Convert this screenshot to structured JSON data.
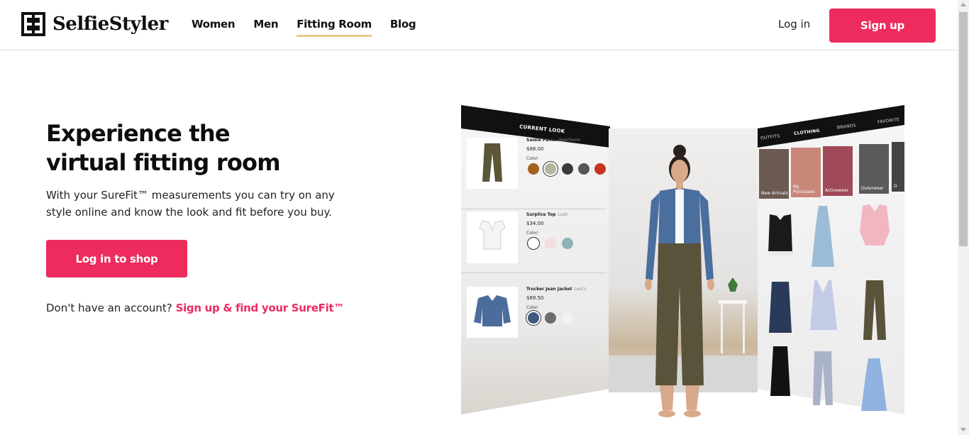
{
  "header": {
    "brand": "SelfieStyler",
    "nav": [
      {
        "label": "Women"
      },
      {
        "label": "Men"
      },
      {
        "label": "Fitting Room",
        "active": true
      },
      {
        "label": "Blog"
      }
    ],
    "login_label": "Log in",
    "signup_label": "Sign up"
  },
  "hero": {
    "title_line1": "Experience the",
    "title_line2": "virtual fitting room",
    "description": "With your SureFit™ measurements you can try on any style online and know the look and fit before you buy.",
    "shop_button": "Log in to shop",
    "account_prompt": "Don't have an account?",
    "account_link": "Sign up & find your SureFit™"
  },
  "fitting_room": {
    "current_look_label": "CURRENT LOOK",
    "items": [
      {
        "name": "Saidie Pants",
        "brand": "Heartloom",
        "price": "$88.00",
        "color_label": "Color:",
        "swatches": [
          "#a4611f",
          "#b6b59d",
          "#3b3b3b",
          "#555657",
          "#c8341f"
        ],
        "img_icon": "pants-icon"
      },
      {
        "name": "Surplice Top",
        "brand": "Lush",
        "price": "$34.00",
        "color_label": "Color:",
        "swatches": [
          "#ffffff",
          "#f6dbe0",
          "#8fb1b7"
        ],
        "img_icon": "top-icon"
      },
      {
        "name": "Trucker Jean Jacket",
        "brand": "Levi's",
        "price": "$89.50",
        "color_label": "Color:",
        "swatches": [
          "#40597d",
          "#6b6f6a",
          "#f2f2f2"
        ],
        "img_icon": "jacket-icon"
      }
    ],
    "tabs": [
      {
        "label": "OUTFITS"
      },
      {
        "label": "CLOTHING",
        "active": true
      },
      {
        "label": "BRANDS"
      },
      {
        "label": "FAVORITE"
      }
    ],
    "categories": [
      {
        "label": "New Arrivals"
      },
      {
        "label": "My Purchases"
      },
      {
        "label": "Activewear"
      },
      {
        "label": "Outerwear"
      },
      {
        "label": "D"
      }
    ],
    "colors": {
      "accent": "#ee2b5d",
      "nav_underline": "#e6c98b",
      "panel_header": "#111111"
    }
  }
}
